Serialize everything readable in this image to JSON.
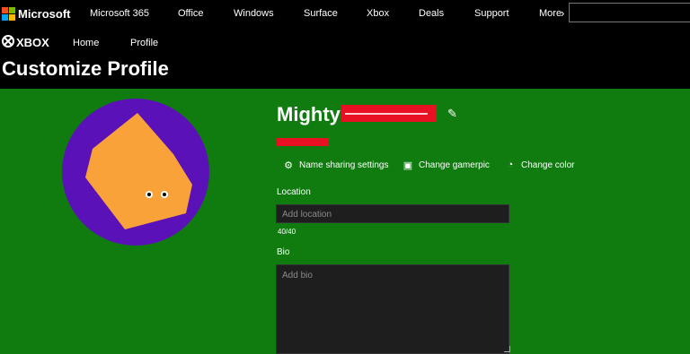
{
  "header": {
    "brand": "Microsoft",
    "nav": [
      "Microsoft 365",
      "Office",
      "Windows",
      "Surface",
      "Xbox",
      "Deals",
      "Support",
      "More"
    ]
  },
  "subheader": {
    "brand": "XBOX",
    "links": [
      "Home",
      "Profile"
    ]
  },
  "page": {
    "title": "Customize Profile",
    "background_color": "#107c10"
  },
  "profile": {
    "gamertag_visible": "Mighty",
    "avatar_bg_color": "#5a12b8",
    "avatar_shape_color": "#f9a23a"
  },
  "actions": [
    {
      "label": "Name sharing settings",
      "icon": "gear-icon"
    },
    {
      "label": "Change gamerpic",
      "icon": "picture-icon"
    },
    {
      "label": "Change color",
      "icon": "palette-icon"
    }
  ],
  "location": {
    "label": "Location",
    "placeholder": "Add location",
    "counter": "40/40"
  },
  "bio": {
    "label": "Bio",
    "placeholder": "Add bio"
  }
}
